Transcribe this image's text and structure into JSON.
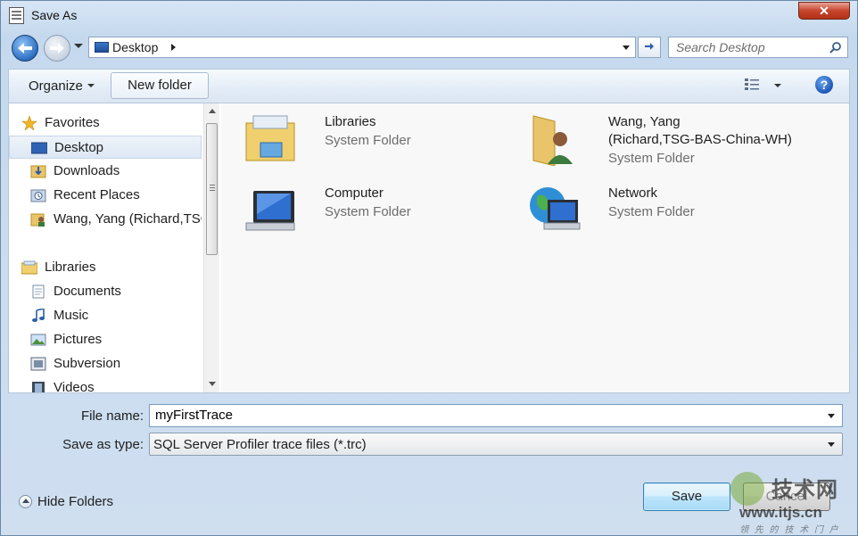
{
  "window": {
    "title": "Save As",
    "close_label": "✕"
  },
  "navbar": {
    "address": "Desktop",
    "search_placeholder": "Search Desktop"
  },
  "toolbar": {
    "organize_label": "Organize",
    "new_folder_label": "New folder",
    "help_label": "?"
  },
  "sidebar": {
    "favorites_label": "Favorites",
    "favorites": [
      {
        "label": "Desktop",
        "icon": "desktop-icon",
        "selected": true
      },
      {
        "label": "Downloads",
        "icon": "downloads-icon"
      },
      {
        "label": "Recent Places",
        "icon": "recent-places-icon"
      },
      {
        "label": "Wang, Yang (Richard,TSG-BAS-China-WH)",
        "icon": "user-folder-icon"
      }
    ],
    "libraries_label": "Libraries",
    "libraries": [
      {
        "label": "Documents",
        "icon": "documents-icon"
      },
      {
        "label": "Music",
        "icon": "music-icon"
      },
      {
        "label": "Pictures",
        "icon": "pictures-icon"
      },
      {
        "label": "Subversion",
        "icon": "subversion-icon"
      },
      {
        "label": "Videos",
        "icon": "videos-icon"
      }
    ]
  },
  "content": {
    "items": [
      {
        "name": "Libraries",
        "type": "System Folder",
        "icon": "libraries-icon"
      },
      {
        "name": "Wang, Yang",
        "name2": "(Richard,TSG-BAS-China-WH)",
        "type": "System Folder",
        "icon": "user-folder-icon"
      },
      {
        "name": "Computer",
        "type": "System Folder",
        "icon": "computer-icon"
      },
      {
        "name": "Network",
        "type": "System Folder",
        "icon": "network-icon"
      }
    ]
  },
  "form": {
    "file_name_label": "File name:",
    "file_name_value": "myFirstTrace",
    "save_as_type_label": "Save as type:",
    "save_as_type_value": "SQL Server Profiler trace files (*.trc)"
  },
  "footer": {
    "hide_folders_label": "Hide Folders",
    "save_label": "Save",
    "cancel_label": "Cancel"
  },
  "watermark": {
    "logo": "技术网",
    "url": "www.itjs.cn",
    "tagline": "领 先 的 技 术 门 户"
  }
}
